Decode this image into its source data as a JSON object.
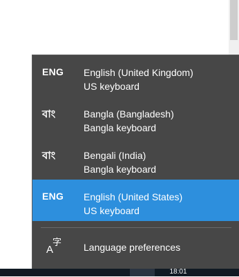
{
  "flyout": {
    "languages": [
      {
        "abbr": "ENG",
        "name": "English (United Kingdom)",
        "layout": "US keyboard",
        "selected": false
      },
      {
        "abbr": "বাং",
        "name": "Bangla (Bangladesh)",
        "layout": "Bangla keyboard",
        "selected": false
      },
      {
        "abbr": "বাং",
        "name": "Bengali (India)",
        "layout": "Bangla keyboard",
        "selected": false
      },
      {
        "abbr": "ENG",
        "name": "English (United States)",
        "layout": "US keyboard",
        "selected": true
      }
    ],
    "preferences": {
      "icon": "language-settings-icon",
      "glyph_latin": "A",
      "glyph_other": "字",
      "label": "Language preferences"
    }
  },
  "taskbar": {
    "clock": "18:01"
  },
  "colors": {
    "flyout_background": "#474747",
    "selected_background": "#2d8fdd",
    "taskbar": "#101a24"
  }
}
